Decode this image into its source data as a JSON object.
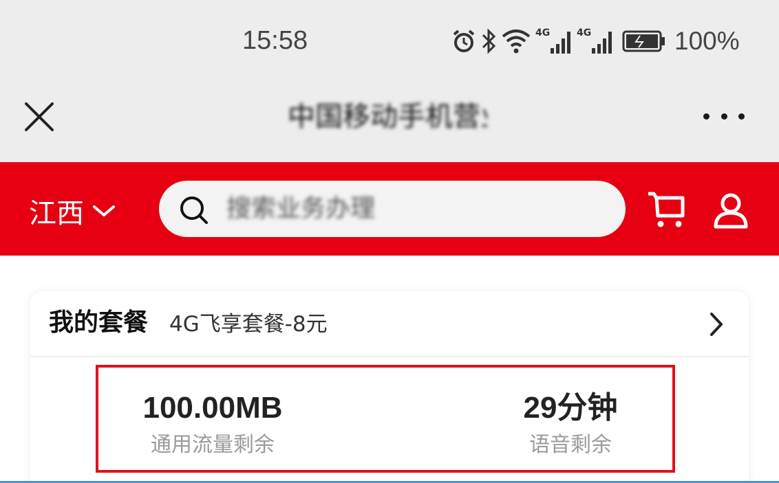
{
  "status_bar": {
    "time": "15:58",
    "network_1": "4G",
    "network_2": "4G",
    "battery": "100%",
    "icons": [
      "alarm-icon",
      "bluetooth-icon",
      "wifi-icon",
      "signal-icon",
      "signal-icon",
      "battery-icon"
    ]
  },
  "title_bar": {
    "title": "中国移动手机营业厅",
    "close_icon": "close-icon",
    "more_icon": "more-icon"
  },
  "header": {
    "region": "江西",
    "search_placeholder": "搜索业务办理",
    "accent_color": "#e60012"
  },
  "plan": {
    "title": "我的套餐",
    "name": "4G飞享套餐-8元",
    "data_remaining_value": "100.00MB",
    "data_remaining_label": "通用流量剩余",
    "voice_remaining_value": "29分钟",
    "voice_remaining_label": "语音剩余"
  }
}
